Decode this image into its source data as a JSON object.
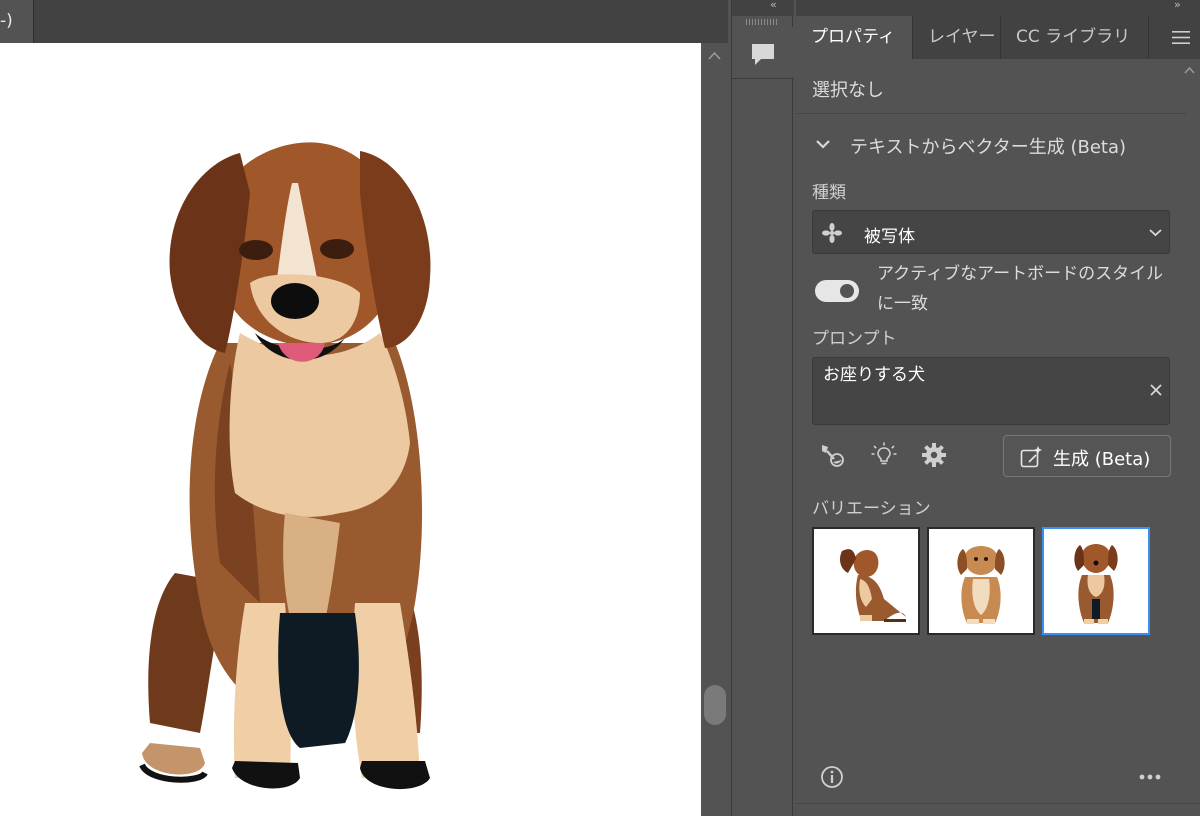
{
  "document": {
    "tab_label": "-)",
    "canvas_background": "#ffffff",
    "artwork": "sitting-dog-vector"
  },
  "dock": {
    "collapse_label": "‹‹",
    "comment_button_icon": "comment-icon"
  },
  "panel": {
    "collapse_label": "››",
    "tabs": [
      {
        "label": "プロパティ",
        "active": true
      },
      {
        "label": "レイヤー",
        "active": false
      },
      {
        "label": "CC ライブラリ",
        "active": false
      }
    ],
    "menu_icon": "hamburger-menu-icon",
    "selection_status": "選択なし",
    "section": {
      "title": "テキストからベクター生成 (Beta)",
      "expanded": true,
      "type_label": "種類",
      "type_value": "被写体",
      "type_icon": "subject-icon",
      "match_artboard_style": {
        "label": "アクティブなアートボードのスタイルに一致",
        "enabled": true
      },
      "prompt_label": "プロンプト",
      "prompt_value": "お座りする犬",
      "tools": [
        "style-picker-icon",
        "lightbulb-icon",
        "gear-icon"
      ],
      "generate_label": "生成 (Beta)",
      "variations_label": "バリエーション",
      "variations": [
        {
          "name": "dog-side-view",
          "selected": false
        },
        {
          "name": "dog-front-light",
          "selected": false
        },
        {
          "name": "dog-front-sitting",
          "selected": true
        }
      ],
      "selected_border_color": "#3b8ff0"
    }
  }
}
